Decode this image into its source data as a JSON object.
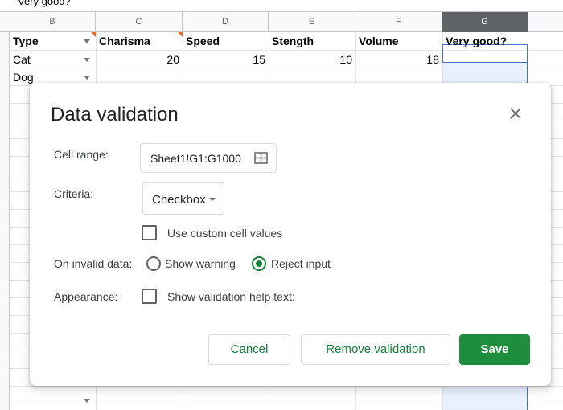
{
  "formula_bar": {
    "content": "Very good?"
  },
  "columns": [
    {
      "letter": "B"
    },
    {
      "letter": "C"
    },
    {
      "letter": "D"
    },
    {
      "letter": "E"
    },
    {
      "letter": "F"
    },
    {
      "letter": "G"
    }
  ],
  "rows": {
    "header": [
      "Type",
      "Charisma",
      "Speed",
      "Stength",
      "Volume",
      "Very good?"
    ],
    "row1": [
      "Cat",
      "20",
      "15",
      "10",
      "18"
    ],
    "row2": [
      "Dog"
    ]
  },
  "dialog": {
    "title": "Data validation",
    "cell_range_label": "Cell range:",
    "cell_range_value": "Sheet1!G1:G1000",
    "criteria_label": "Criteria:",
    "criteria_value": "Checkbox",
    "custom_values_label": "Use custom cell values",
    "on_invalid_label": "On invalid data:",
    "show_warning_label": "Show warning",
    "reject_input_label": "Reject input",
    "appearance_label": "Appearance:",
    "help_text_label": "Show validation help text:",
    "cancel_label": "Cancel",
    "remove_label": "Remove validation",
    "save_label": "Save"
  },
  "colors": {
    "accent": "#1e8e3e",
    "selection": "#e8f0fe",
    "selection_border": "#4a6fd8"
  }
}
